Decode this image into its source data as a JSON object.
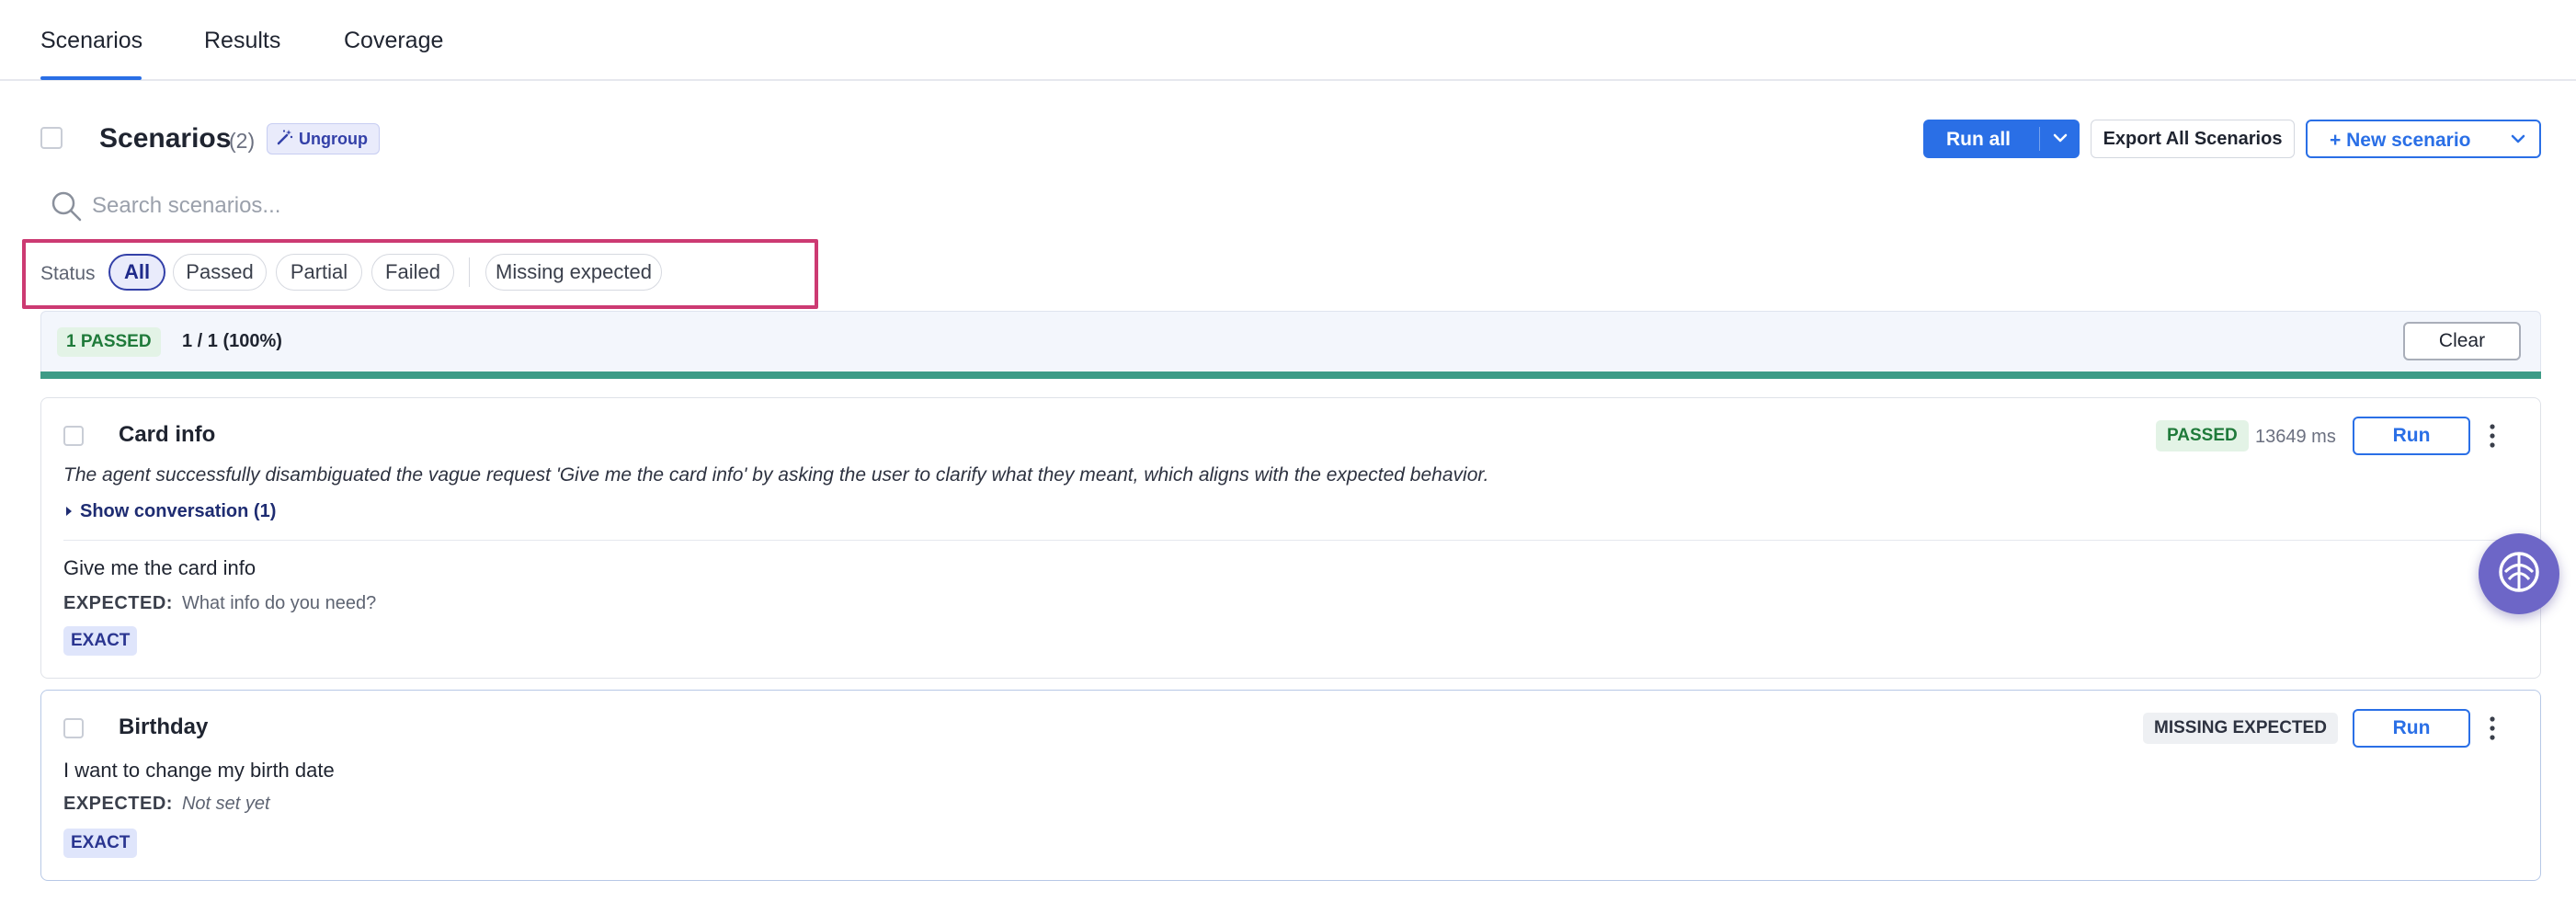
{
  "tabs": [
    {
      "label": "Scenarios",
      "active": true
    },
    {
      "label": "Results",
      "active": false
    },
    {
      "label": "Coverage",
      "active": false
    }
  ],
  "header": {
    "title": "Scenarios",
    "count": "(2)",
    "ungroup_label": "Ungroup",
    "run_all_label": "Run all",
    "export_label": "Export All Scenarios",
    "new_scenario_label": "+ New scenario"
  },
  "search": {
    "placeholder": "Search scenarios...",
    "value": ""
  },
  "filters": {
    "label": "Status",
    "chips": [
      "All",
      "Passed",
      "Partial",
      "Failed",
      "Missing expected"
    ],
    "selected": "All"
  },
  "summary": {
    "badge": "1 PASSED",
    "ratio": "1 / 1 (100%)",
    "progress_fraction": 1.0,
    "clear_label": "Clear"
  },
  "scenarios": [
    {
      "name": "Card info",
      "status": "PASSED",
      "duration": "13649 ms",
      "run_label": "Run",
      "description": "The agent successfully disambiguated the vague request 'Give me the card info' by asking the user to clarify what they meant, which aligns with the expected behavior.",
      "show_conversation": "Show conversation (1)",
      "input": "Give me the card info",
      "expected_label": "EXPECTED:",
      "expected": "What info do you need?",
      "match_type": "EXACT"
    },
    {
      "name": "Birthday",
      "status": "MISSING EXPECTED",
      "run_label": "Run",
      "input": "I want to change my birth date",
      "expected_label": "EXPECTED:",
      "expected": "Not set yet",
      "match_type": "EXACT"
    }
  ],
  "colors": {
    "accent": "#2a6fe6",
    "highlight_frame": "#cc3a72",
    "passed_green": "#1f7a3a",
    "progress": "#3d9b86",
    "fab": "#6d66c7"
  },
  "icons": [
    "search-icon",
    "magic-wand-icon",
    "chevron-down-icon",
    "caret-right-icon",
    "kebab-menu-icon",
    "help-assistant-icon"
  ]
}
